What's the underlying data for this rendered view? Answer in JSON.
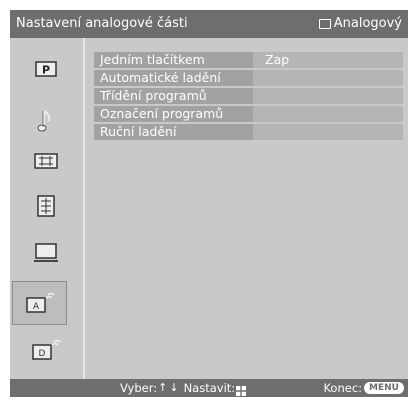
{
  "header": {
    "title": "Nastavení analogové části",
    "mode_label": "Analogový"
  },
  "sidebar": {
    "items": [
      {
        "icon": "picture-icon"
      },
      {
        "icon": "sound-icon"
      },
      {
        "icon": "screen-icon"
      },
      {
        "icon": "setup-icon"
      },
      {
        "icon": "pc-icon"
      },
      {
        "icon": "analog-setup-icon",
        "selected": true
      },
      {
        "icon": "digital-setup-icon"
      }
    ]
  },
  "menu": {
    "rows": [
      {
        "label": "Jedním tlačítkem",
        "value": "Zap"
      },
      {
        "label": "Automatické ladění",
        "value": ""
      },
      {
        "label": "Třídění programů",
        "value": ""
      },
      {
        "label": "Označení programů",
        "value": ""
      },
      {
        "label": "Ruční ladění",
        "value": ""
      }
    ]
  },
  "footer": {
    "select_label": "Vyber:",
    "set_label": "Nastavit:",
    "exit_label": "Konec:",
    "menu_key": "MENU"
  },
  "colors": {
    "bar": "#6e6e6e",
    "panel": "#c9c9c9",
    "row": "#a2a2a2",
    "value_cell": "#b5b5b5"
  }
}
